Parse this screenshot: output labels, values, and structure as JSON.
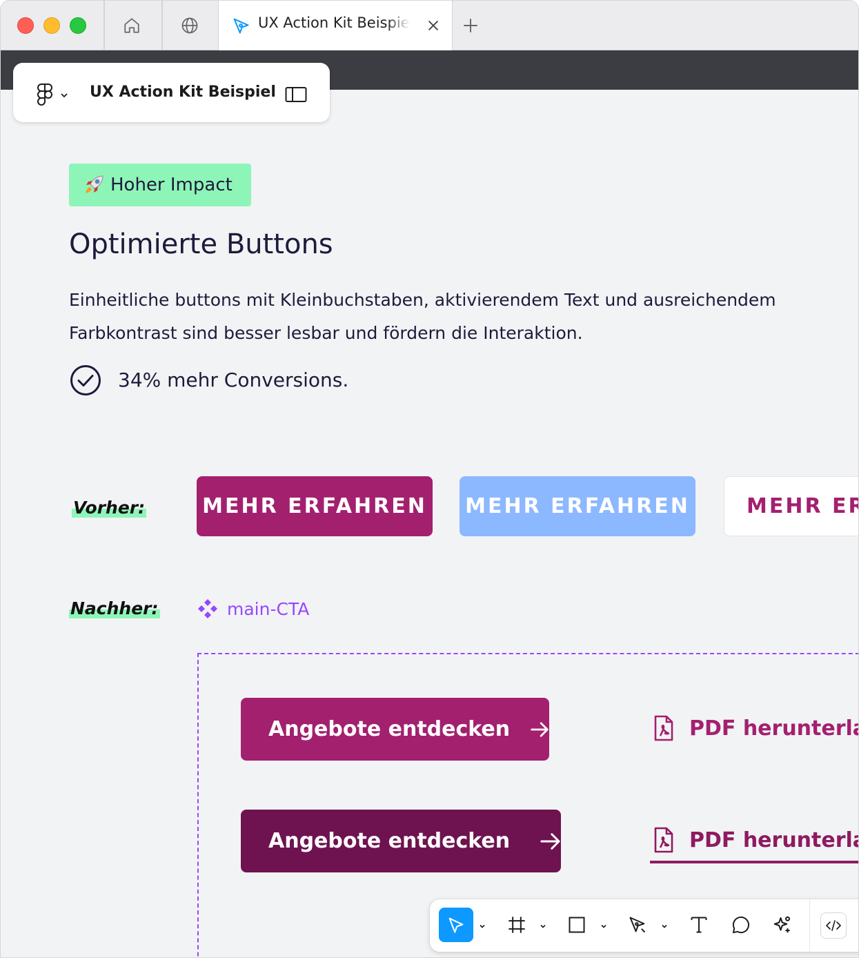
{
  "browser": {
    "tab_title": "UX Action Kit Beispiel",
    "icons": [
      "home-icon",
      "globe-icon",
      "figma-tab-icon",
      "close-icon",
      "plus-icon"
    ]
  },
  "file": {
    "title": "UX Action Kit Beispiel"
  },
  "content": {
    "badge": "Hoher Impact",
    "heading": "Optimierte Buttons",
    "paragraph": "Einheitliche buttons mit Kleinbuchstaben, aktivierendem Text und ausreichendem Farbkontrast sind besser lesbar und fördern die Interaktion.",
    "result": "34% mehr Conversions.",
    "before_label": "Vorher:",
    "after_label": "Nachher:",
    "old_buttons": [
      "MEHR ERFAHREN",
      "MEHR ERFAHREN",
      "MEHR ERFAHREN"
    ],
    "component_name": "main-CTA",
    "new_button_label": "Angebote entdecken",
    "pdf_label": "PDF herunterladen"
  },
  "colors": {
    "accent": "#a3206f",
    "accent_dark": "#6e1350",
    "light_blue": "#8cb8ff",
    "highlight_green": "#8ef5b8",
    "component_purple": "#9747ff",
    "select_blue": "#0d99ff"
  }
}
